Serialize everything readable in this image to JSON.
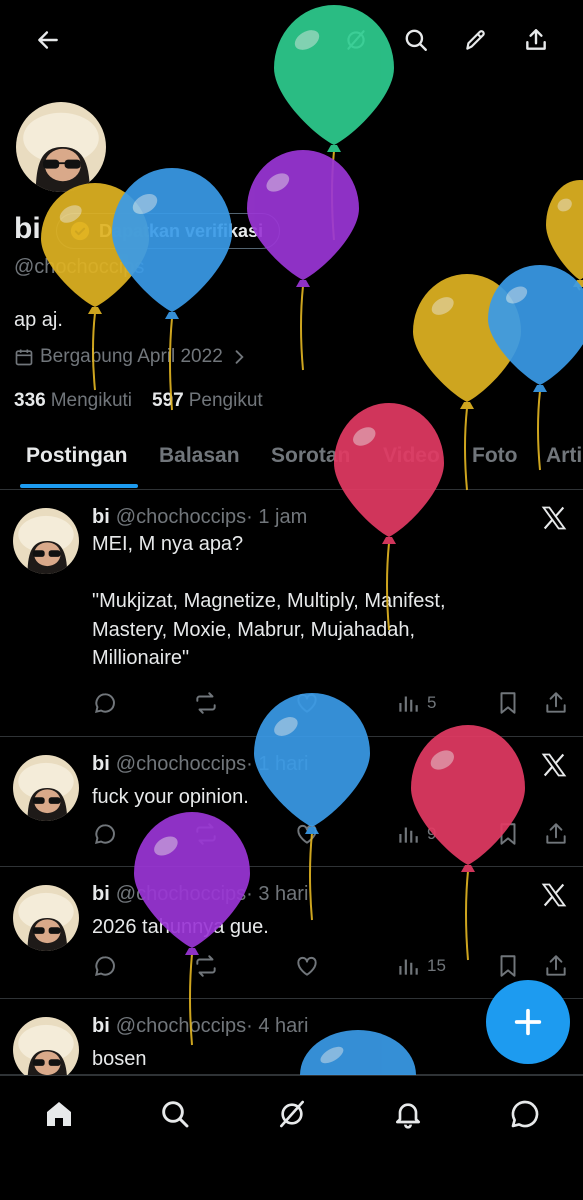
{
  "header": {
    "back_icon": "arrow-left-icon",
    "icons": [
      "grok-icon",
      "search-icon",
      "edit-icon",
      "share-icon"
    ]
  },
  "profile": {
    "name": "bi",
    "verify_label": "Dapatkan verifikasi",
    "handle": "@chochoccips",
    "bio": "ap aj.",
    "joined": "Bergabung April 2022",
    "following_count": "336",
    "following_label": "Mengikuti",
    "followers_count": "597",
    "followers_label": "Pengikut"
  },
  "tabs": [
    {
      "label": "Postingan"
    },
    {
      "label": "Balasan"
    },
    {
      "label": "Sorotan"
    },
    {
      "label": "Video"
    },
    {
      "label": "Foto"
    },
    {
      "label": "Artikel"
    }
  ],
  "posts": [
    {
      "name": "bi",
      "handle": "@chochoccips",
      "time": "· 1 jam",
      "text": "MEI, M nya apa?\n\n\"Mukjizat, Magnetize, Multiply, Manifest,\nMastery, Moxie, Mabrur, Mujahadah,\nMillionaire\"",
      "views": "5"
    },
    {
      "name": "bi",
      "handle": "@chochoccips",
      "time": "· 1 hari",
      "text": "fuck your opinion.",
      "views": "9"
    },
    {
      "name": "bi",
      "handle": "@chochoccips",
      "time": "· 3 hari",
      "text": "2026 tahunnya gue.",
      "views": "15"
    },
    {
      "name": "bi",
      "handle": "@chochoccips",
      "time": "· 4 hari",
      "text": "bosen",
      "views": ""
    }
  ],
  "bottom_nav": [
    "home-icon",
    "search-icon",
    "grok-icon",
    "notifications-icon",
    "messages-icon"
  ],
  "colors": {
    "accent": "#1d9bf0",
    "text": "#e7e9ea",
    "muted": "#71767b",
    "divider": "#2f3336",
    "balloons": [
      "#2ecc8f",
      "#e0b322",
      "#3a9be8",
      "#9b36d6",
      "#e23a63"
    ]
  }
}
